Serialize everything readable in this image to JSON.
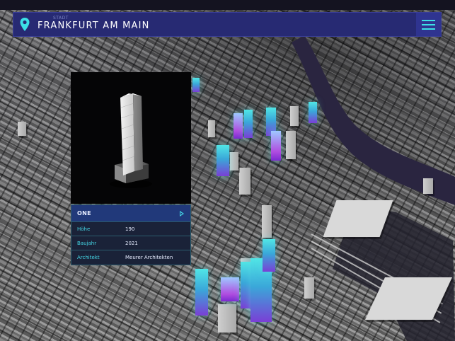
{
  "header": {
    "city_label": "STADT",
    "city_name": "FRANKFURT AM MAIN",
    "menu_icon": "hamburger-menu-icon",
    "pin_icon": "location-pin-icon"
  },
  "building": {
    "name": "ONE",
    "details": [
      {
        "key": "Höhe",
        "value": "190"
      },
      {
        "key": "Baujahr",
        "value": "2021"
      },
      {
        "key": "Architekt",
        "value": "Meurer Architekten"
      }
    ]
  },
  "colors": {
    "header_bg": "#272a73",
    "accent": "#3ce0e6",
    "panel_bg": "#1a2238",
    "highlight_top": "#51e6e6",
    "highlight_bottom": "#7a3fd6"
  }
}
